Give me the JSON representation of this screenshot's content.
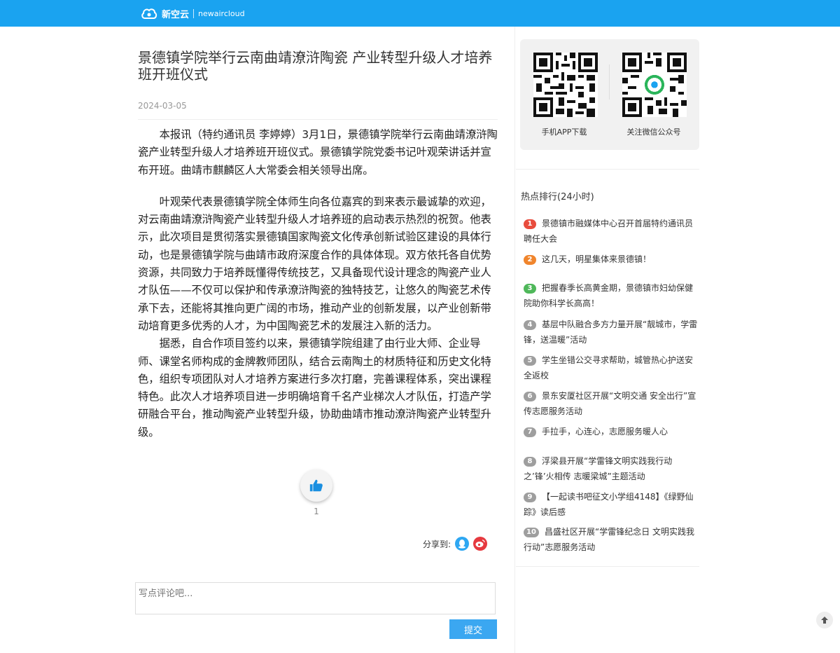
{
  "header": {
    "logo_cn": "新空云",
    "logo_en": "newaircloud",
    "bg_color": "#1aa3f0"
  },
  "article": {
    "title": "景德镇学院举行云南曲靖潦浒陶瓷 产业转型升级人才培养班开班仪式",
    "date": "2024-03-05",
    "paragraphs": [
      "本报讯（特约通讯员 李婷婷）3月1日，景德镇学院举行云南曲靖潦浒陶瓷产业转型升级人才培养班开班仪式。景德镇学院党委书记叶观荣讲话并宣布开班。曲靖市麒麟区人大常委会相关领导出席。",
      "叶观荣代表景德镇学院全体师生向各位嘉宾的到来表示最诚挚的欢迎，对云南曲靖潦浒陶瓷产业转型升级人才培养班的启动表示热烈的祝贺。他表示，此次项目是贯彻落实景德镇国家陶瓷文化传承创新试验区建设的具体行动，也是景德镇学院与曲靖市政府深度合作的具体体现。双方依托各自优势资源，共同致力于培养既懂得传统技艺，又具备现代设计理念的陶瓷产业人才队伍——不仅可以保护和传承潦浒陶瓷的独特技艺，让悠久的陶瓷艺术传承下去，还能将其推向更广阔的市场，推动产业的创新发展，以产业创新带动培育更多优秀的人才，为中国陶瓷艺术的发展注入新的活力。",
      "据悉，自合作项目签约以来，景德镇学院组建了由行业大师、企业导师、课堂名师构成的金牌教师团队，结合云南陶土的材质特征和历史文化特色，组织专项团队对人才培养方案进行多次打磨，完善课程体系，突出课程特色。此次人才培养项目进一步明确培育千名产业梯次人才队伍，打造产学研融合平台，推动陶瓷产业转型升级，协助曲靖市推动潦浒陶瓷产业转型升级。"
    ],
    "like_count": "1",
    "share_label": "分享到:"
  },
  "comment": {
    "placeholder": "写点评论吧...",
    "submit_label": "提交"
  },
  "sidebar": {
    "qr_app_label": "手机APP下载",
    "qr_wechat_label": "关注微信公众号",
    "hot_title": "热点排行(24小时)",
    "hot_items": [
      {
        "rank": "1",
        "color": "#e84c3d",
        "text": "景德镇市融媒体中心召开首届特约通讯员聘任大会"
      },
      {
        "rank": "2",
        "color": "#f0852d",
        "text": "这几天，明星集体来景德镇！"
      },
      {
        "rank": "3",
        "color": "#4fb85a",
        "text": "把握春季长高黄金期，景德镇市妇幼保健院助你科学长高高！"
      },
      {
        "rank": "4",
        "color": "#9e9e9e",
        "text": "基层中队融合多方力量开展“靓城市，学雷锋，送温暖”活动"
      },
      {
        "rank": "5",
        "color": "#9e9e9e",
        "text": "学生坐错公交寻求帮助，城管热心护送安全返校"
      },
      {
        "rank": "6",
        "color": "#9e9e9e",
        "text": "景东安厦社区开展“文明交通 安全出行”宣传志愿服务活动"
      },
      {
        "rank": "7",
        "color": "#9e9e9e",
        "text": "手拉手，心连心，志愿服务暖人心"
      },
      {
        "rank": "8",
        "color": "#9e9e9e",
        "text": "浮梁县开展“学雷锋文明实践我行动之’锋’火相传 志暖梁城”主题活动"
      },
      {
        "rank": "9",
        "color": "#9e9e9e",
        "text": "【一起读书吧征文小学组4148】《绿野仙踪》读后感"
      },
      {
        "rank": "10",
        "color": "#9e9e9e",
        "text": "昌盛社区开展“学雷锋纪念日 文明实践我行动”志愿服务活动"
      }
    ]
  }
}
